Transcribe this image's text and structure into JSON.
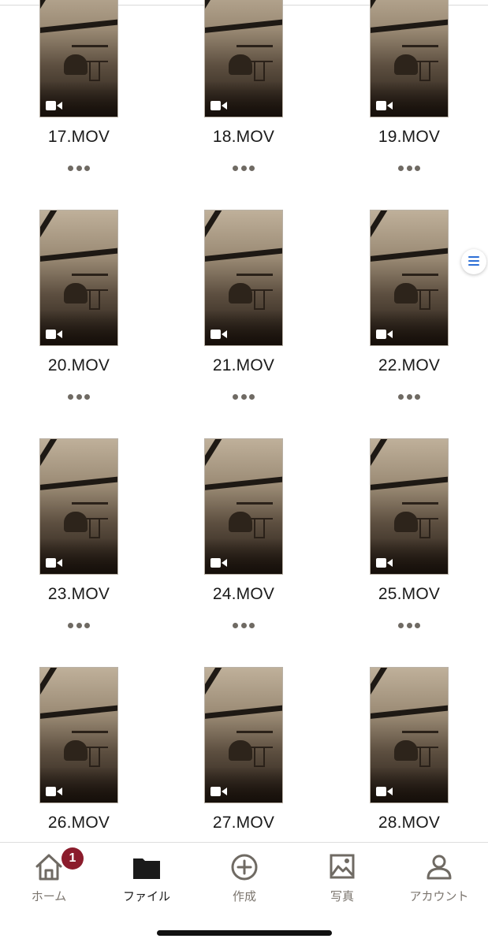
{
  "files": [
    {
      "name": "17.MOV",
      "type_icon": "video-camera-icon"
    },
    {
      "name": "18.MOV",
      "type_icon": "video-camera-icon"
    },
    {
      "name": "19.MOV",
      "type_icon": "video-camera-icon"
    },
    {
      "name": "20.MOV",
      "type_icon": "video-camera-icon"
    },
    {
      "name": "21.MOV",
      "type_icon": "video-camera-icon"
    },
    {
      "name": "22.MOV",
      "type_icon": "video-camera-icon"
    },
    {
      "name": "23.MOV",
      "type_icon": "video-camera-icon"
    },
    {
      "name": "24.MOV",
      "type_icon": "video-camera-icon"
    },
    {
      "name": "25.MOV",
      "type_icon": "video-camera-icon"
    },
    {
      "name": "26.MOV",
      "type_icon": "video-camera-icon"
    },
    {
      "name": "27.MOV",
      "type_icon": "video-camera-icon"
    },
    {
      "name": "28.MOV",
      "type_icon": "video-camera-icon"
    }
  ],
  "side_menu": {
    "icon": "list-menu-icon"
  },
  "tabbar": {
    "tabs": [
      {
        "label": "ホーム",
        "icon": "home-icon",
        "badge": "1",
        "active": false
      },
      {
        "label": "ファイル",
        "icon": "folder-icon",
        "active": true
      },
      {
        "label": "作成",
        "icon": "plus-circle-icon",
        "active": false
      },
      {
        "label": "写真",
        "icon": "photo-icon",
        "active": false
      },
      {
        "label": "アカウント",
        "icon": "account-icon",
        "active": false
      }
    ]
  },
  "colors": {
    "badge": "#8b1c2c",
    "inactive_label": "#7b756e",
    "active_icon": "#1a1a1a",
    "side_menu_accent": "#2d6fd6"
  }
}
